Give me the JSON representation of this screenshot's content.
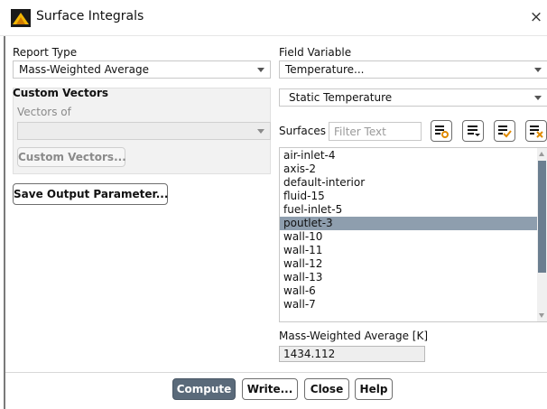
{
  "window": {
    "title": "Surface Integrals",
    "close_glyph": "×"
  },
  "report_type": {
    "label": "Report Type",
    "value": "Mass-Weighted Average"
  },
  "custom_vectors": {
    "heading": "Custom Vectors",
    "vectors_of_label": "Vectors of",
    "vectors_of_value": "",
    "button": "Custom Vectors..."
  },
  "save_output_button": "Save Output Parameter...",
  "field_variable": {
    "label": "Field Variable",
    "category": "Temperature...",
    "variable": "Static Temperature"
  },
  "surfaces": {
    "label": "Surfaces",
    "filter_placeholder": "Filter Text",
    "items": [
      {
        "name": "air-inlet-4",
        "selected": false
      },
      {
        "name": "axis-2",
        "selected": false
      },
      {
        "name": "default-interior",
        "selected": false
      },
      {
        "name": "fluid-15",
        "selected": false
      },
      {
        "name": "fuel-inlet-5",
        "selected": false
      },
      {
        "name": "poutlet-3",
        "selected": true
      },
      {
        "name": "wall-10",
        "selected": false
      },
      {
        "name": "wall-11",
        "selected": false
      },
      {
        "name": "wall-12",
        "selected": false
      },
      {
        "name": "wall-13",
        "selected": false
      },
      {
        "name": "wall-6",
        "selected": false
      },
      {
        "name": "wall-7",
        "selected": false
      }
    ]
  },
  "result": {
    "label": "Mass-Weighted Average [K]",
    "value": "1434.112"
  },
  "buttons": {
    "compute": "Compute",
    "write": "Write...",
    "close": "Close",
    "help": "Help"
  },
  "icons": {
    "app": "fluent-icon",
    "toolbar": [
      "select-all-icon",
      "deselect-all-icon",
      "select-selected-icon",
      "deselect-icon"
    ]
  },
  "colors": {
    "selected_row": "#8e9eae",
    "scrollbar_thumb": "#6b7e90",
    "primary_button": "#5a6a7a"
  }
}
